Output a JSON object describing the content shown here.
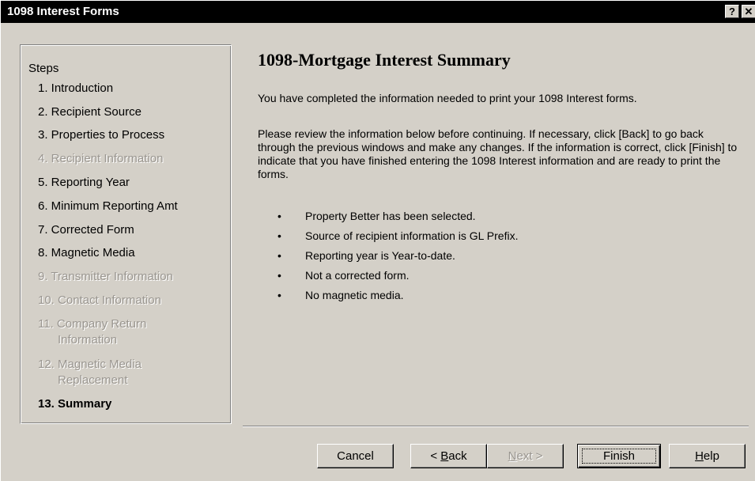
{
  "window": {
    "title": "1098 Interest Forms",
    "help_glyph": "?",
    "close_glyph": "✕"
  },
  "steps": {
    "header": "Steps",
    "items": [
      {
        "label": "1. Introduction",
        "state": "enabled"
      },
      {
        "label": "2. Recipient Source",
        "state": "enabled"
      },
      {
        "label": "3. Properties to Process",
        "state": "enabled"
      },
      {
        "label": "4. Recipient Information",
        "state": "disabled"
      },
      {
        "label": "5. Reporting Year",
        "state": "enabled"
      },
      {
        "label": "6. Minimum Reporting Amt",
        "state": "enabled"
      },
      {
        "label": "7. Corrected Form",
        "state": "enabled"
      },
      {
        "label": "8. Magnetic Media",
        "state": "enabled"
      },
      {
        "label": "9. Transmitter Information",
        "state": "disabled"
      },
      {
        "label": "10. Contact Information",
        "state": "disabled"
      },
      {
        "label_line1": "11. Company Return",
        "label_line2": "Information",
        "state": "disabled"
      },
      {
        "label_line1": "12. Magnetic Media",
        "label_line2": "Replacement",
        "state": "disabled"
      },
      {
        "label": "13. Summary",
        "state": "current"
      }
    ]
  },
  "main": {
    "title": "1098-Mortgage Interest Summary",
    "intro": "You have completed the information needed to print your 1098 Interest forms.",
    "review": "Please review the information below before continuing.  If necessary, click [Back] to go back through the previous windows and make any changes.  If the information is correct, click [Finish] to indicate that you have finished entering the 1098 Interest information and are ready to print the forms.",
    "bullet_glyph": "•",
    "bullets": [
      "Property Better has been selected.",
      "Source of recipient information is GL Prefix.",
      "Reporting year is Year-to-date.",
      "Not a corrected form.",
      "No magnetic media."
    ]
  },
  "buttons": {
    "cancel": "Cancel",
    "back_prefix": "< ",
    "back_mnemonic": "B",
    "back_rest": "ack",
    "next_mnemonic": "N",
    "next_rest": "ext >",
    "finish": "Finish",
    "help_mnemonic": "H",
    "help_rest": "elp"
  }
}
